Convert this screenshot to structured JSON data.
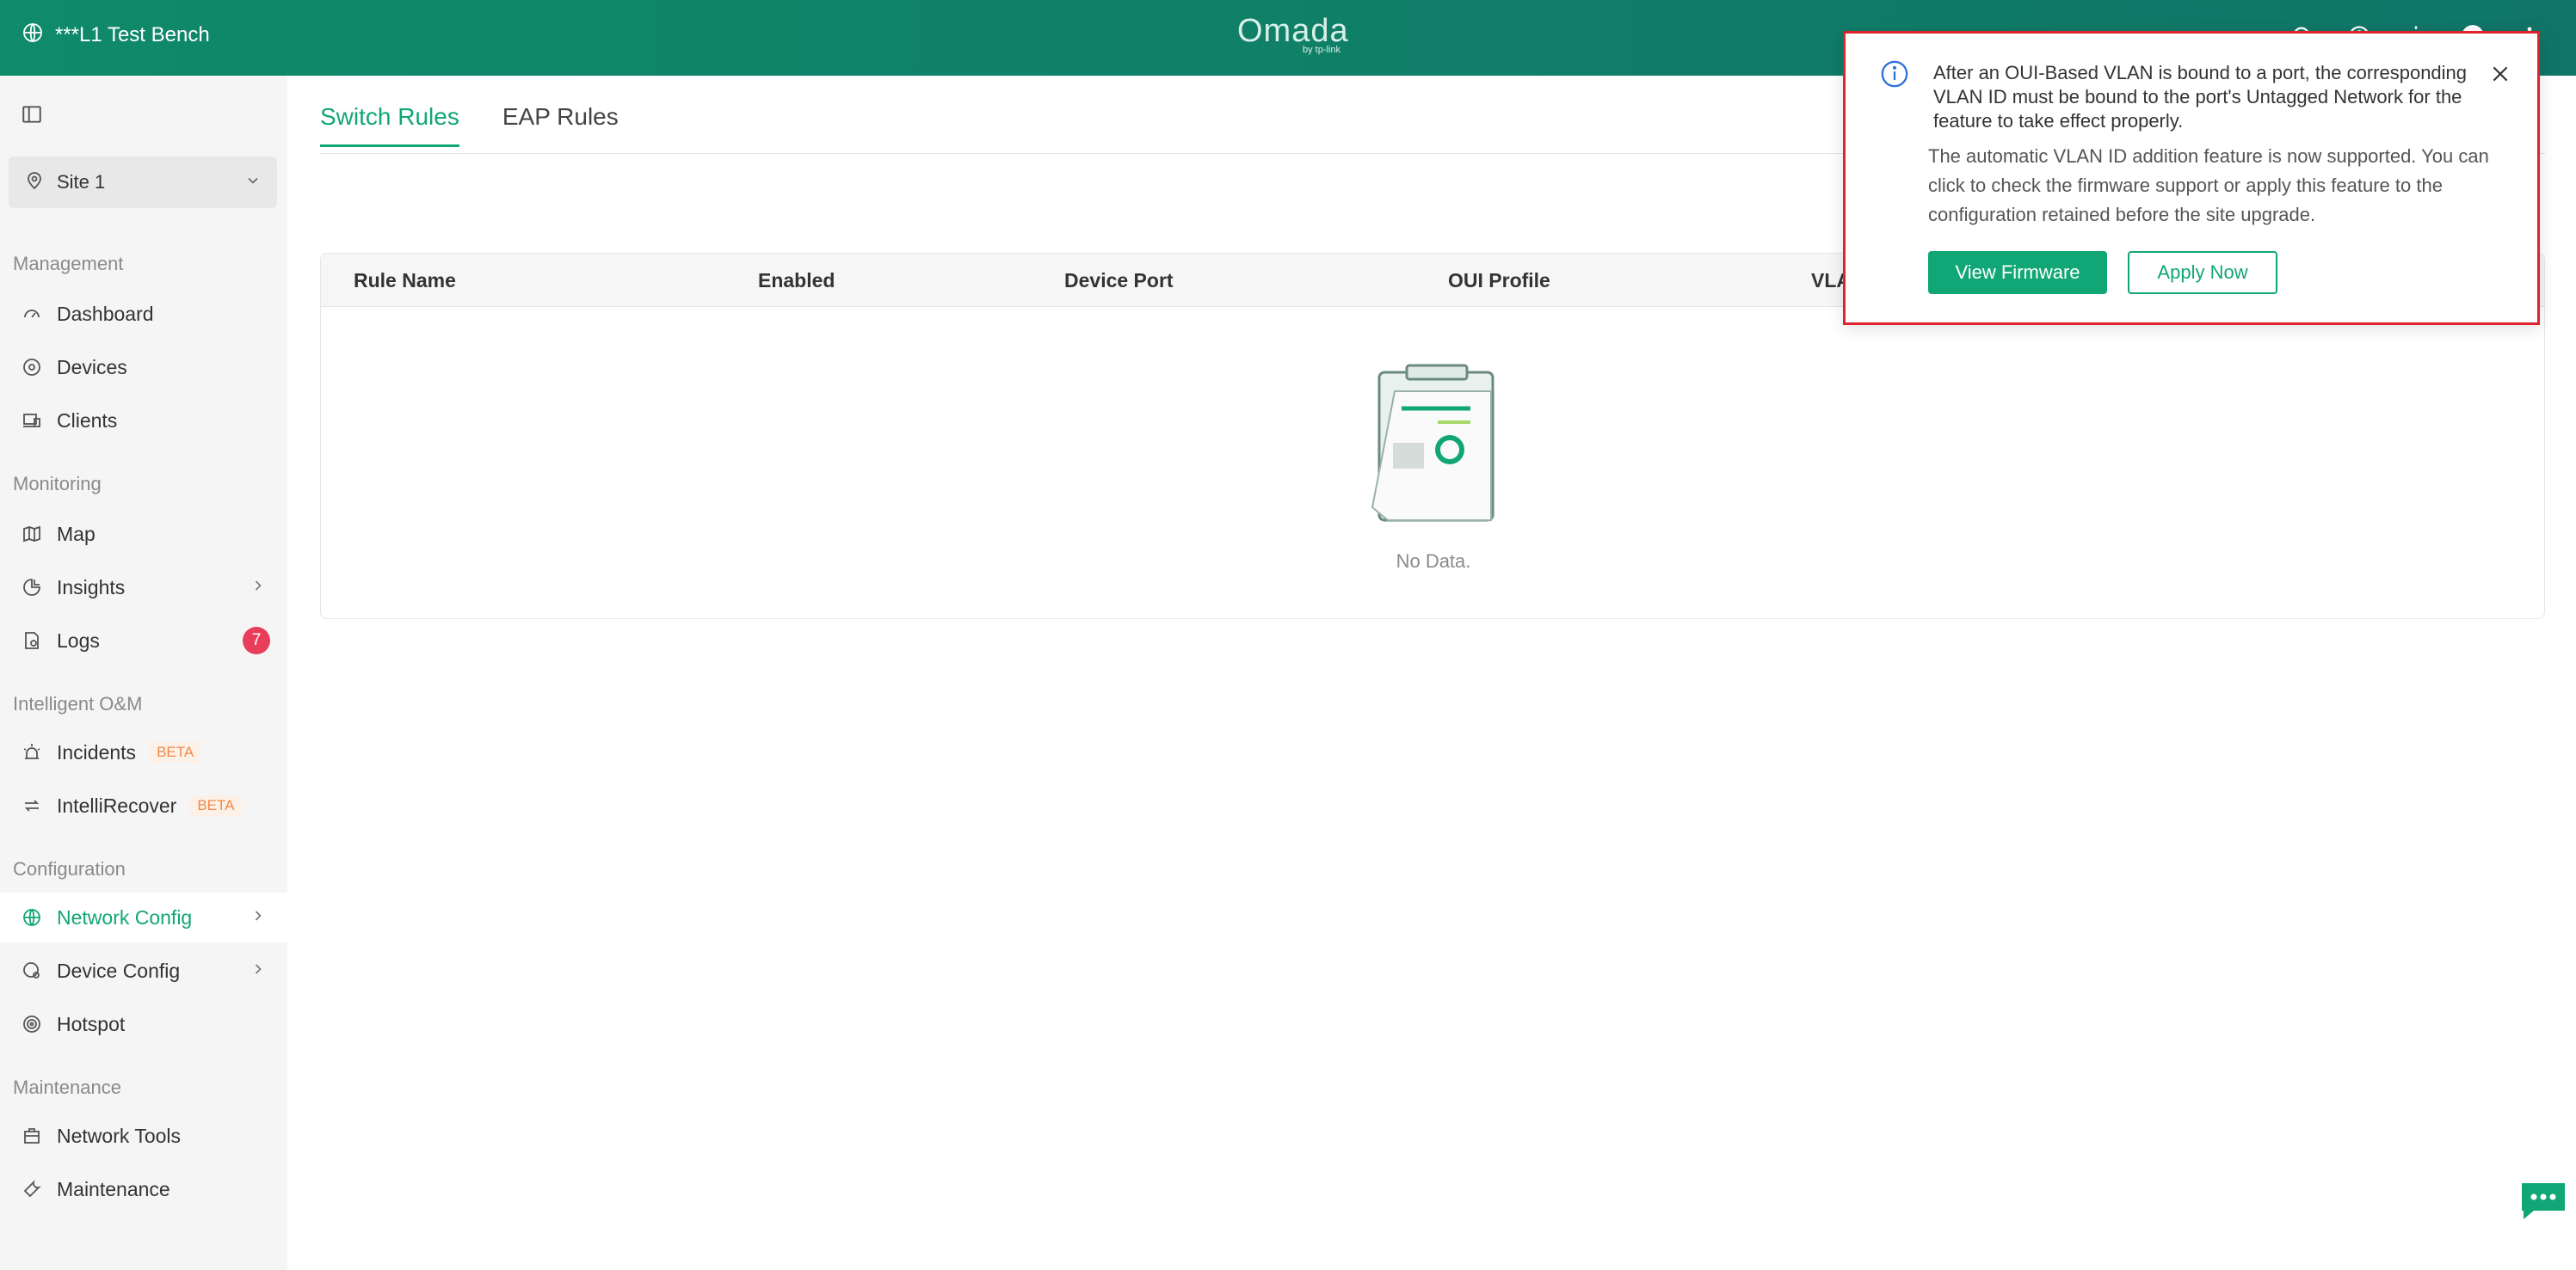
{
  "topbar": {
    "site_name": "***L1 Test Bench",
    "logo_text": "Omada",
    "logo_sub": "by tp-link"
  },
  "sidebar": {
    "site_selector": "Site 1",
    "sections": {
      "management": "Management",
      "monitoring": "Monitoring",
      "intelligent": "Intelligent O&M",
      "configuration": "Configuration",
      "maintenance": "Maintenance"
    },
    "items": {
      "dashboard": "Dashboard",
      "devices": "Devices",
      "clients": "Clients",
      "map": "Map",
      "insights": "Insights",
      "logs": "Logs",
      "logs_count": "7",
      "incidents": "Incidents",
      "intellirecover": "IntelliRecover",
      "beta": "BETA",
      "network_config": "Network Config",
      "device_config": "Device Config",
      "hotspot": "Hotspot",
      "network_tools": "Network Tools",
      "maintenance": "Maintenance"
    }
  },
  "main": {
    "tabs": [
      "Switch Rules",
      "EAP Rules"
    ],
    "table": {
      "columns": [
        "Rule Name",
        "Enabled",
        "Device Port",
        "OUI Profile",
        "VLA"
      ],
      "empty_text": "No Data."
    }
  },
  "popup": {
    "message": "After an OUI-Based VLAN is bound to a port, the corresponding VLAN ID must be bound to the port's Untagged Network for the feature to take effect properly.",
    "detail": "The automatic VLAN ID addition feature is now supported. You can click to check the firmware support or apply this feature to the configuration retained before the site upgrade.",
    "primary_button": "View Firmware",
    "secondary_button": "Apply Now"
  },
  "colors": {
    "brand": "#11a676",
    "topbar": "#0f8a6a",
    "highlight_border": "#e0232b",
    "badge": "#e83e5a"
  }
}
